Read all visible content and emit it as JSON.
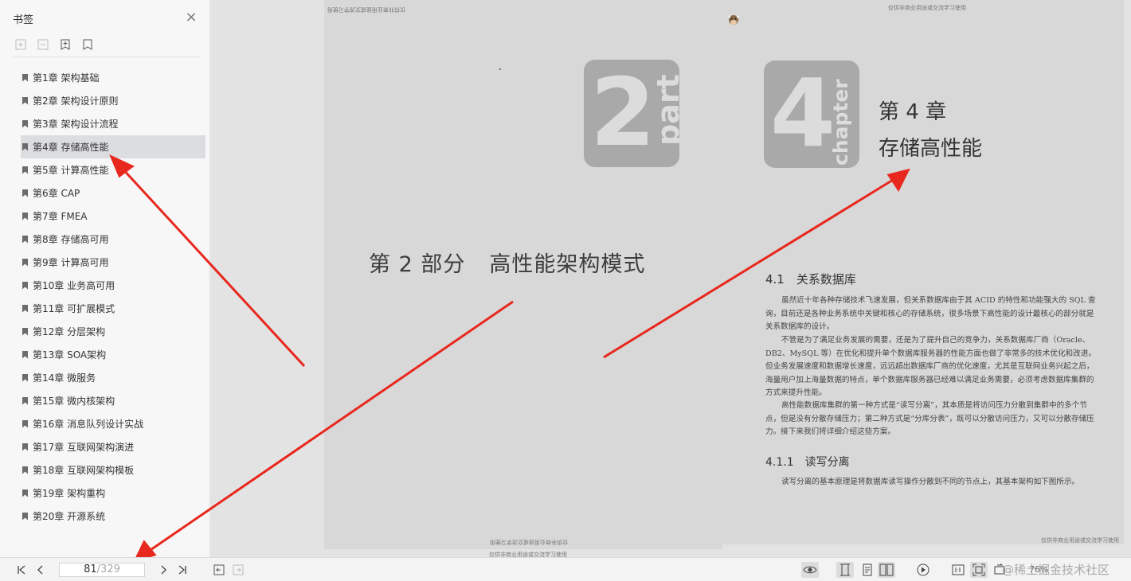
{
  "sidebar": {
    "title": "书签",
    "items": [
      {
        "label": "第1章 架构基础"
      },
      {
        "label": "第2章 架构设计原则"
      },
      {
        "label": "第3章 架构设计流程"
      },
      {
        "label": "第4章 存储高性能",
        "active": true
      },
      {
        "label": "第5章 计算高性能"
      },
      {
        "label": "第6章 CAP"
      },
      {
        "label": "第7章 FMEA"
      },
      {
        "label": "第8章 存储高可用"
      },
      {
        "label": "第9章 计算高可用"
      },
      {
        "label": "第10章 业务高可用"
      },
      {
        "label": "第11章 可扩展模式"
      },
      {
        "label": "第12章 分层架构"
      },
      {
        "label": "第13章 SOA架构"
      },
      {
        "label": "第14章 微服务"
      },
      {
        "label": "第15章 微内核架构"
      },
      {
        "label": "第16章 消息队列设计实战"
      },
      {
        "label": "第17章 互联网架构演进"
      },
      {
        "label": "第18章 互联网架构模板"
      },
      {
        "label": "第19章 架构重构"
      },
      {
        "label": "第20章 开源系统"
      }
    ]
  },
  "left_page": {
    "header_mirrored": "仅供非商业用途或交流学习使用",
    "badge_number": "2",
    "badge_word": "part",
    "part_label": "第 2 部分",
    "part_title": "高性能架构模式",
    "footer_mirrored": "仅供非商业用途或交流学习使用",
    "footer_below": "仅供非商业用途或交流学习使用"
  },
  "right_page": {
    "header": "仅供非商业用途或交流学习使用",
    "badge_number": "4",
    "badge_word": "chapter",
    "chapter_num": "第 4 章",
    "chapter_name": "存储高性能",
    "section_4_1": "4.1　关系数据库",
    "para1": "虽然近十年各种存储技术飞速发展，但关系数据库由于其 ACID 的特性和功能强大的 SQL 查询，目前还是各种业务系统中关键和核心的存储系统，很多场景下高性能的设计最核心的部分就是关系数据库的设计。",
    "para2": "不管是为了满足业务发展的需要，还是为了提升自己的竞争力，关系数据库厂商（Oracle、DB2、MySQL 等）在优化和提升单个数据库服务器的性能方面也做了非常多的技术优化和改进。但业务发展速度和数据增长速度，远远超出数据库厂商的优化速度，尤其是互联网业务兴起之后，海量用户加上海量数据的特点，单个数据库服务器已经难以满足业务需要，必须考虑数据库集群的方式来提升性能。",
    "para3": "高性能数据库集群的第一种方式是“读写分离”，其本质是将访问压力分散到集群中的多个节点，但是没有分散存储压力；第二种方式是“分库分表”，既可以分散访问压力，又可以分散存储压力。接下来我们将详细介绍这些方案。",
    "section_4_1_1": "4.1.1　读写分离",
    "para4": "读写分离的基本原理是将数据库读写操作分散到不同的节点上，其基本架构如下图所示。",
    "footer": "仅供非商业用途或交流学习使用"
  },
  "toolbar": {
    "current_page": "81",
    "total_pages": "/329",
    "zoom": "76%",
    "watermark": "@稀土掘金技术社区"
  },
  "colors": {
    "arrow": "#e8281e",
    "active_item": "#dcdde1",
    "badge": "#a9a9a9"
  }
}
